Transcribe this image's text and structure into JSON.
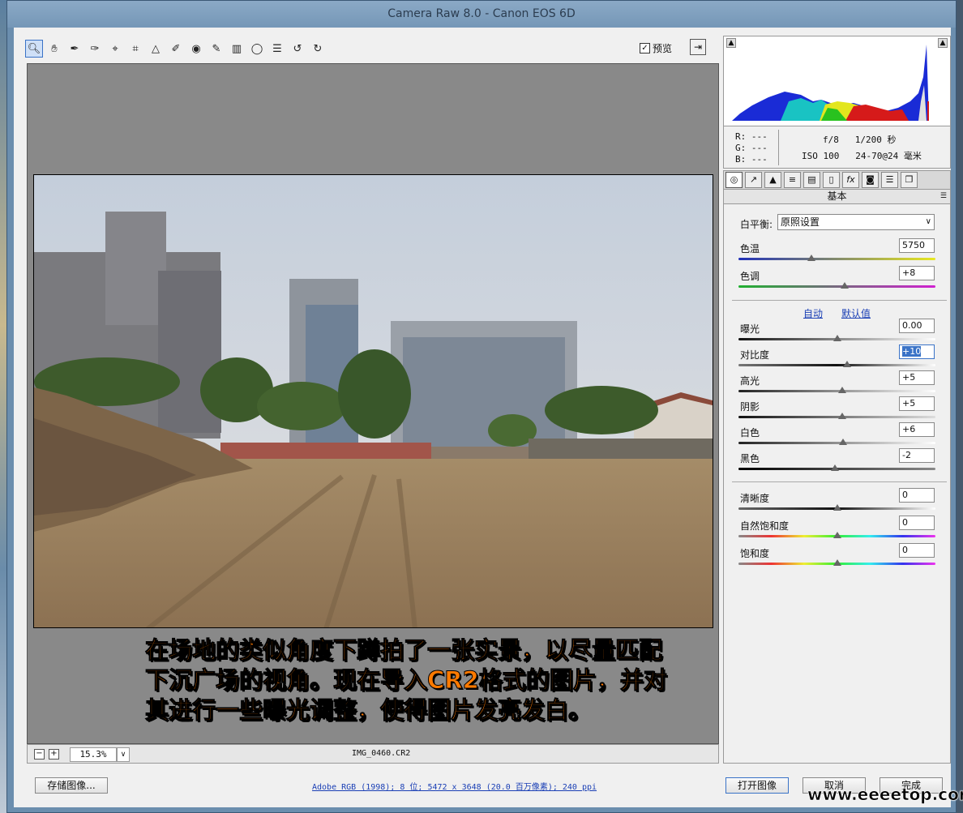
{
  "window": {
    "title": "Camera Raw 8.0 -  Canon EOS 6D"
  },
  "toolbar": {
    "tools": [
      "zoom-tool",
      "hand-tool",
      "white-balance-tool",
      "color-sampler-tool",
      "targeted-adjustment-tool",
      "crop-tool",
      "straighten-tool",
      "spot-removal-tool",
      "red-eye-tool",
      "adjustment-brush-tool",
      "graduated-filter-tool",
      "radial-filter-tool",
      "preferences-tool",
      "rotate-ccw-tool",
      "rotate-cw-tool"
    ],
    "preview_label": "预览",
    "preview_checked": true
  },
  "canvas": {
    "overlay_text": "在场地的类似角度下蹲拍了一张实景，以尽量匹配下沉广场的视角。现在导入CR2格式的图片，并对其进行一些曝光调整，使得图片发亮发白。",
    "zoom_value": "15.3%",
    "filename": "IMG_0460.CR2"
  },
  "camera_info": {
    "r_label": "R:",
    "r_value": "---",
    "g_label": "G:",
    "g_value": "---",
    "b_label": "B:",
    "b_value": "---",
    "aperture": "f/8",
    "shutter": "1/200 秒",
    "iso": "ISO 100",
    "lens": "24-70@24 毫米"
  },
  "panel": {
    "title": "基本",
    "white_balance_label": "白平衡:",
    "white_balance_value": "原照设置",
    "temp": {
      "label": "色温",
      "value": "5750",
      "level": 0.37
    },
    "tint": {
      "label": "色调",
      "value": "+8",
      "level": 0.54
    },
    "auto_label": "自动",
    "default_label": "默认值",
    "exposure": {
      "label": "曝光",
      "value": "0.00",
      "level": 0.5
    },
    "contrast": {
      "label": "对比度",
      "value": "+10",
      "level": 0.55
    },
    "highlights": {
      "label": "高光",
      "value": "+5",
      "level": 0.525
    },
    "shadows": {
      "label": "阴影",
      "value": "+5",
      "level": 0.525
    },
    "whites": {
      "label": "白色",
      "value": "+6",
      "level": 0.53
    },
    "blacks": {
      "label": "黑色",
      "value": "-2",
      "level": 0.49
    },
    "clarity": {
      "label": "清晰度",
      "value": "0",
      "level": 0.5
    },
    "vibrance": {
      "label": "自然饱和度",
      "value": "0",
      "level": 0.5
    },
    "saturation": {
      "label": "饱和度",
      "value": "0",
      "level": 0.5
    }
  },
  "footer": {
    "save_label": "存储图像...",
    "workflow_text": "Adobe RGB (1998); 8 位; 5472 x 3648 (20.0 百万像素); 240 ppi",
    "open_label": "打开图像",
    "cancel_label": "取消",
    "done_label": "完成"
  },
  "watermark": "www.eeeetop.com",
  "colors": {
    "accent": "#3a73c7",
    "overlay_text": "#ff7a00",
    "link": "#1a3fb5"
  }
}
